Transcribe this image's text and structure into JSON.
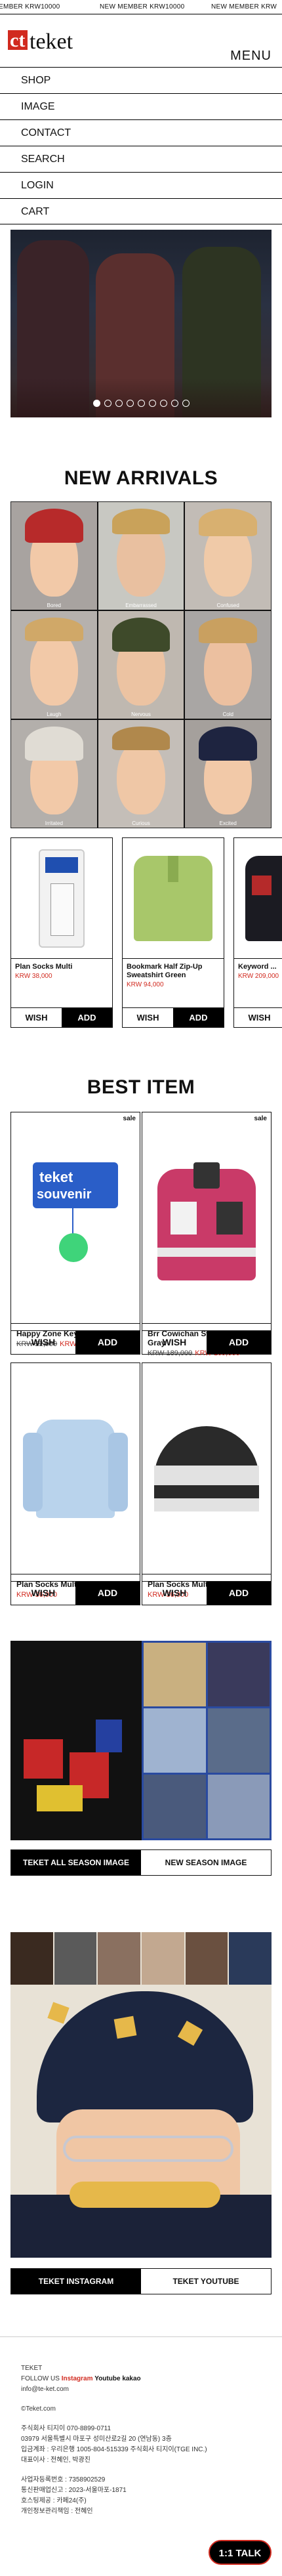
{
  "marquee": {
    "items": [
      "EMBER KRW10000",
      "NEW MEMBER KRW10000",
      "NEW MEMBER KRW"
    ]
  },
  "header": {
    "logo_text": "teket",
    "menu_label": "MENU"
  },
  "menu": {
    "items": [
      "SHOP",
      "IMAGE",
      "CONTACT",
      "SEARCH",
      "LOGIN",
      "CART"
    ]
  },
  "hero": {
    "slide_count": 9,
    "active_index": 0
  },
  "new_arrivals": {
    "title": "NEW ARRIVALS",
    "tiles": [
      "Bored",
      "Embarrassed",
      "Confused",
      "Laugh",
      "Nervous",
      "Cold",
      "Irritated",
      "Curious",
      "Excited"
    ],
    "products": [
      {
        "name": "Plan Socks Multi",
        "price": "KRW 38,000"
      },
      {
        "name": "Bookmark Half Zip-Up Sweatshirt Green",
        "price": "KRW 94,000"
      },
      {
        "name": "Keyword ...",
        "price": "KRW 209,000"
      }
    ],
    "wish_label": "WISH",
    "add_label": "ADD"
  },
  "best_item": {
    "title": "BEST ITEM",
    "sale_label": "sale",
    "items": [
      {
        "name": "Happy Zone Keyring Neon",
        "old_price": "KRW 22,000",
        "price": "KRW 17,000",
        "sale": true
      },
      {
        "name": "Brr Cowichan Sweater Melange Gray",
        "old_price": "KRW 189,000",
        "price": "KRW 169,000",
        "sale": true
      },
      {
        "name": "Plan Socks Multi",
        "old_price": "",
        "price": "KRW 36,000",
        "sale": false
      },
      {
        "name": "Plan Socks Multi",
        "old_price": "",
        "price": "KRW 36,000",
        "sale": false
      }
    ],
    "wish_label": "WISH",
    "add_label": "ADD"
  },
  "lookbook": {
    "tabs": [
      "TEKET ALL SEASON IMAGE",
      "NEW SEASON IMAGE"
    ]
  },
  "instagram": {
    "tabs": [
      "TEKET INSTAGRAM",
      "TEKET YOUTUBE"
    ]
  },
  "footer": {
    "brand": "TEKET",
    "follow_label": "FOLLOW US",
    "instagram": "Instagram",
    "youtube": "Youtube",
    "kakao": "kakao",
    "email": "info@te-ket.com",
    "copyright": "©Teket.com",
    "lines": [
      "주식회사 티지이 070-8899-0711",
      "03979 서울특별시 마포구 성미산로2길 20 (연남동) 3층",
      "입금계좌 : 우리은행 1005-804-515339 주식회사 티지이(TGE INC.)",
      "대표이사 : 전혜인, 박광진"
    ],
    "lines2": [
      "사업자등록번호 : 7358902529",
      "통신판매업신고 : 2023-서울마포-1871",
      "호스팅제공 : 카페24(주)",
      "개인정보관리책임 : 전혜인"
    ]
  },
  "chat": {
    "label": "1:1 TALK"
  },
  "colors": {
    "accent_red": "#d12a1f",
    "black": "#000000"
  }
}
